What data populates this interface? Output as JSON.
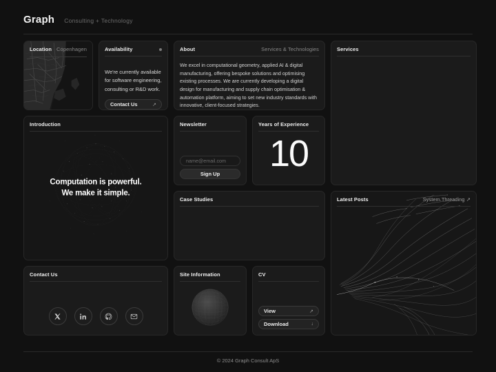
{
  "header": {
    "brand": "Graph",
    "tagline": "Consulting + Technology"
  },
  "cards": {
    "location": {
      "title": "Location",
      "city": "Copenhagen"
    },
    "availability": {
      "title": "Availability",
      "status_color": "#7b7b7b",
      "body": "We're currently available for software engineering, consulting or R&D work.",
      "cta_label": "Contact Us",
      "cta_arrow": "↗"
    },
    "about": {
      "title": "About",
      "meta": "Services & Technologies",
      "body": "We excel in computational geometry, applied AI & digital manufacturing, offering bespoke solutions and optimising existing processes. We are currently developing a digital design for manufacturing and supply chain optimisation & automation platform, aiming to set new industry standards with innovative, client-focused strategies."
    },
    "services": {
      "title": "Services"
    },
    "introduction": {
      "title": "Introduction",
      "headline_line1": "Computation is powerful.",
      "headline_line2": "We make it simple."
    },
    "newsletter": {
      "title": "Newsletter",
      "email_placeholder": "name@email.com",
      "email_value": "",
      "signup_label": "Sign Up"
    },
    "years": {
      "title": "Years of Experience",
      "value": "10"
    },
    "case_studies": {
      "title": "Case Studies"
    },
    "latest_posts": {
      "title": "Latest Posts",
      "link_label": "System.Threading",
      "link_arrow": "↗"
    },
    "contact": {
      "title": "Contact Us",
      "socials": [
        {
          "name": "x-twitter",
          "label": "X"
        },
        {
          "name": "linkedin",
          "label": "in"
        },
        {
          "name": "github",
          "label": "GitHub"
        },
        {
          "name": "email",
          "label": "Email"
        }
      ]
    },
    "site_information": {
      "title": "Site Information"
    },
    "cv": {
      "title": "CV",
      "view_label": "View",
      "view_arrow": "↗",
      "download_label": "Download",
      "download_arrow": "↓"
    }
  },
  "footer": {
    "copyright": "© 2024 Graph Consult ApS"
  }
}
